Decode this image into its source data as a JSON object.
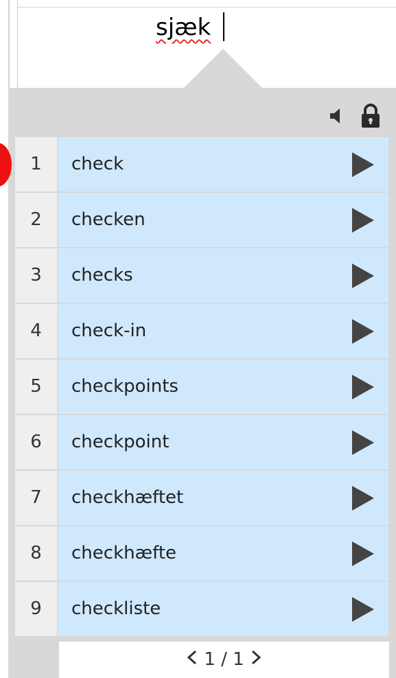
{
  "editor": {
    "typed_word": "sjæk"
  },
  "toolbar": {
    "speaker_icon": "speaker-icon",
    "lock_icon": "lock-icon"
  },
  "suggestions": [
    {
      "number": "1",
      "word": "check"
    },
    {
      "number": "2",
      "word": "checken"
    },
    {
      "number": "3",
      "word": "checks"
    },
    {
      "number": "4",
      "word": "check-in"
    },
    {
      "number": "5",
      "word": "checkpoints"
    },
    {
      "number": "6",
      "word": "checkpoint"
    },
    {
      "number": "7",
      "word": "checkhæftet"
    },
    {
      "number": "8",
      "word": "checkhæfte"
    },
    {
      "number": "9",
      "word": "checkliste"
    }
  ],
  "pager": {
    "text": "1 / 1"
  },
  "colors": {
    "row_highlight": "#cfe8fc",
    "number_cell": "#efefef",
    "popup_bg": "#d8d8d8",
    "cursor_marker": "#ee1111"
  }
}
